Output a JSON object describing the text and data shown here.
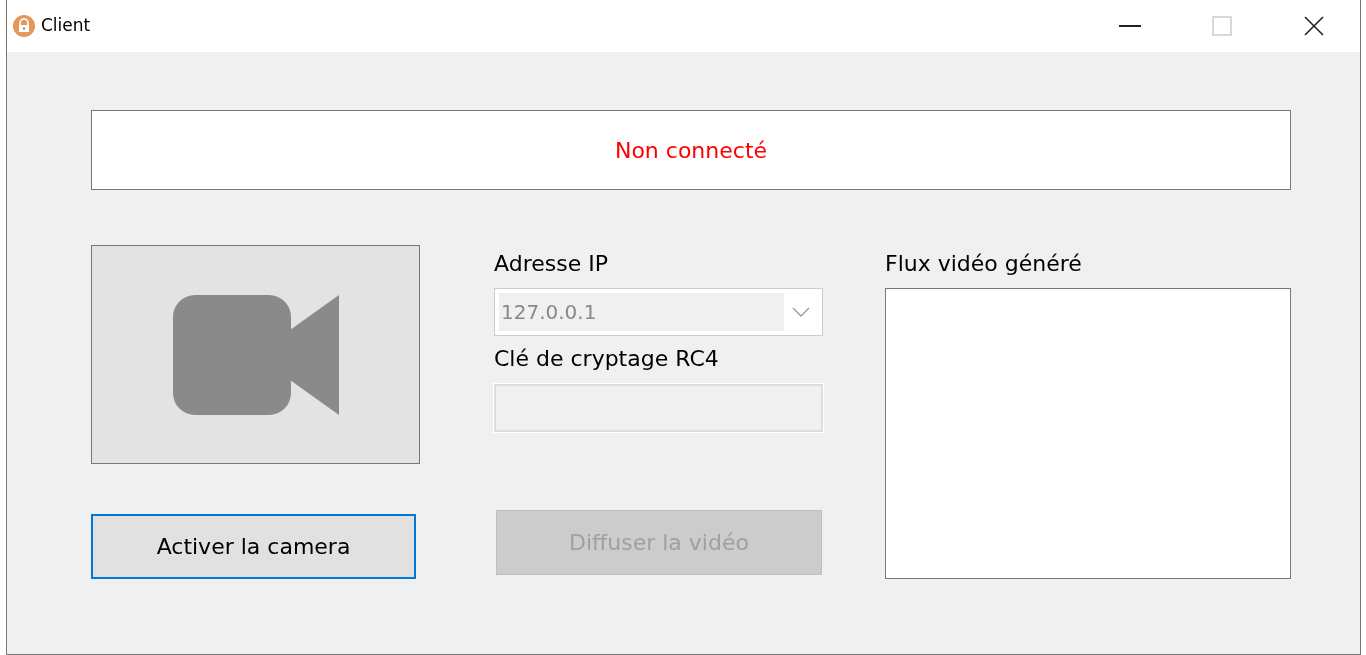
{
  "window": {
    "title": "Client"
  },
  "status": {
    "text": "Non connecté",
    "color": "#ff0000"
  },
  "camera_button": {
    "label": "Activer la camera",
    "focused": true
  },
  "ip": {
    "label": "Adresse IP",
    "value": "127.0.0.1",
    "disabled": true
  },
  "key": {
    "label": "Clé de cryptage RC4",
    "disabled": true
  },
  "stream_button": {
    "label": "Diffuser la vidéo",
    "disabled": true
  },
  "output": {
    "label": "Flux vidéo généré"
  }
}
